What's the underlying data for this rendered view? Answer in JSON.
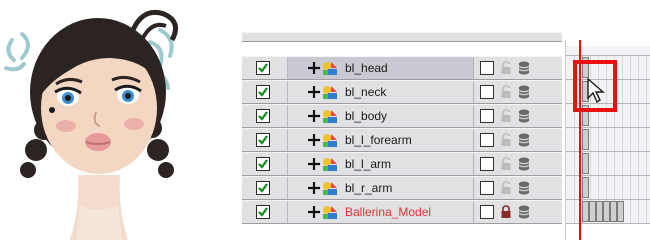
{
  "layers": [
    {
      "name": "bl_head",
      "checked": true,
      "selected": true,
      "name_color": "#1a1a1a",
      "lock": "open"
    },
    {
      "name": "bl_neck",
      "checked": true,
      "selected": false,
      "name_color": "#1a1a1a",
      "lock": "open"
    },
    {
      "name": "bl_body",
      "checked": true,
      "selected": false,
      "name_color": "#1a1a1a",
      "lock": "open"
    },
    {
      "name": "bl_l_forearm",
      "checked": true,
      "selected": false,
      "name_color": "#1a1a1a",
      "lock": "open"
    },
    {
      "name": "bl_l_arm",
      "checked": true,
      "selected": false,
      "name_color": "#1a1a1a",
      "lock": "open"
    },
    {
      "name": "bl_r_arm",
      "checked": true,
      "selected": false,
      "name_color": "#1a1a1a",
      "lock": "open"
    },
    {
      "name": "Ballerina_Model",
      "checked": true,
      "selected": false,
      "name_color": "#e23232",
      "lock": "closed"
    }
  ],
  "icons": {
    "checkbox": "checkmark-icon",
    "expand": "plus-icon",
    "layer_type": "layer-type-icon",
    "lock": "lock-icon",
    "database": "database-icon",
    "cursor": "mouse-cursor-icon"
  },
  "colors": {
    "accent_red": "#e8100f",
    "checkmark": "#0f8a1e",
    "panel": "#e1e1e4"
  }
}
